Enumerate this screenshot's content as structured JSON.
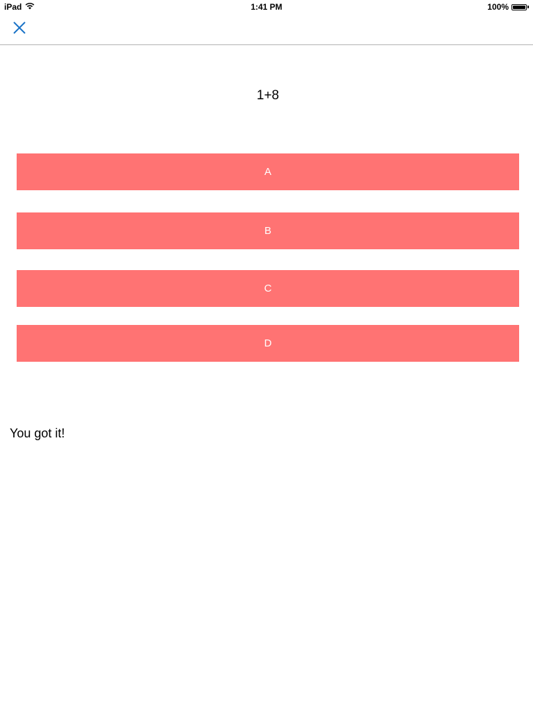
{
  "status_bar": {
    "device": "iPad",
    "time": "1:41 PM",
    "battery": "100%"
  },
  "nav": {
    "close_icon": "close-icon",
    "accent_color": "#1a73c7"
  },
  "quiz": {
    "question": "1+8",
    "answers": [
      "A",
      "B",
      "C",
      "D"
    ],
    "answer_color": "#ff7373",
    "feedback": "You got it!"
  }
}
